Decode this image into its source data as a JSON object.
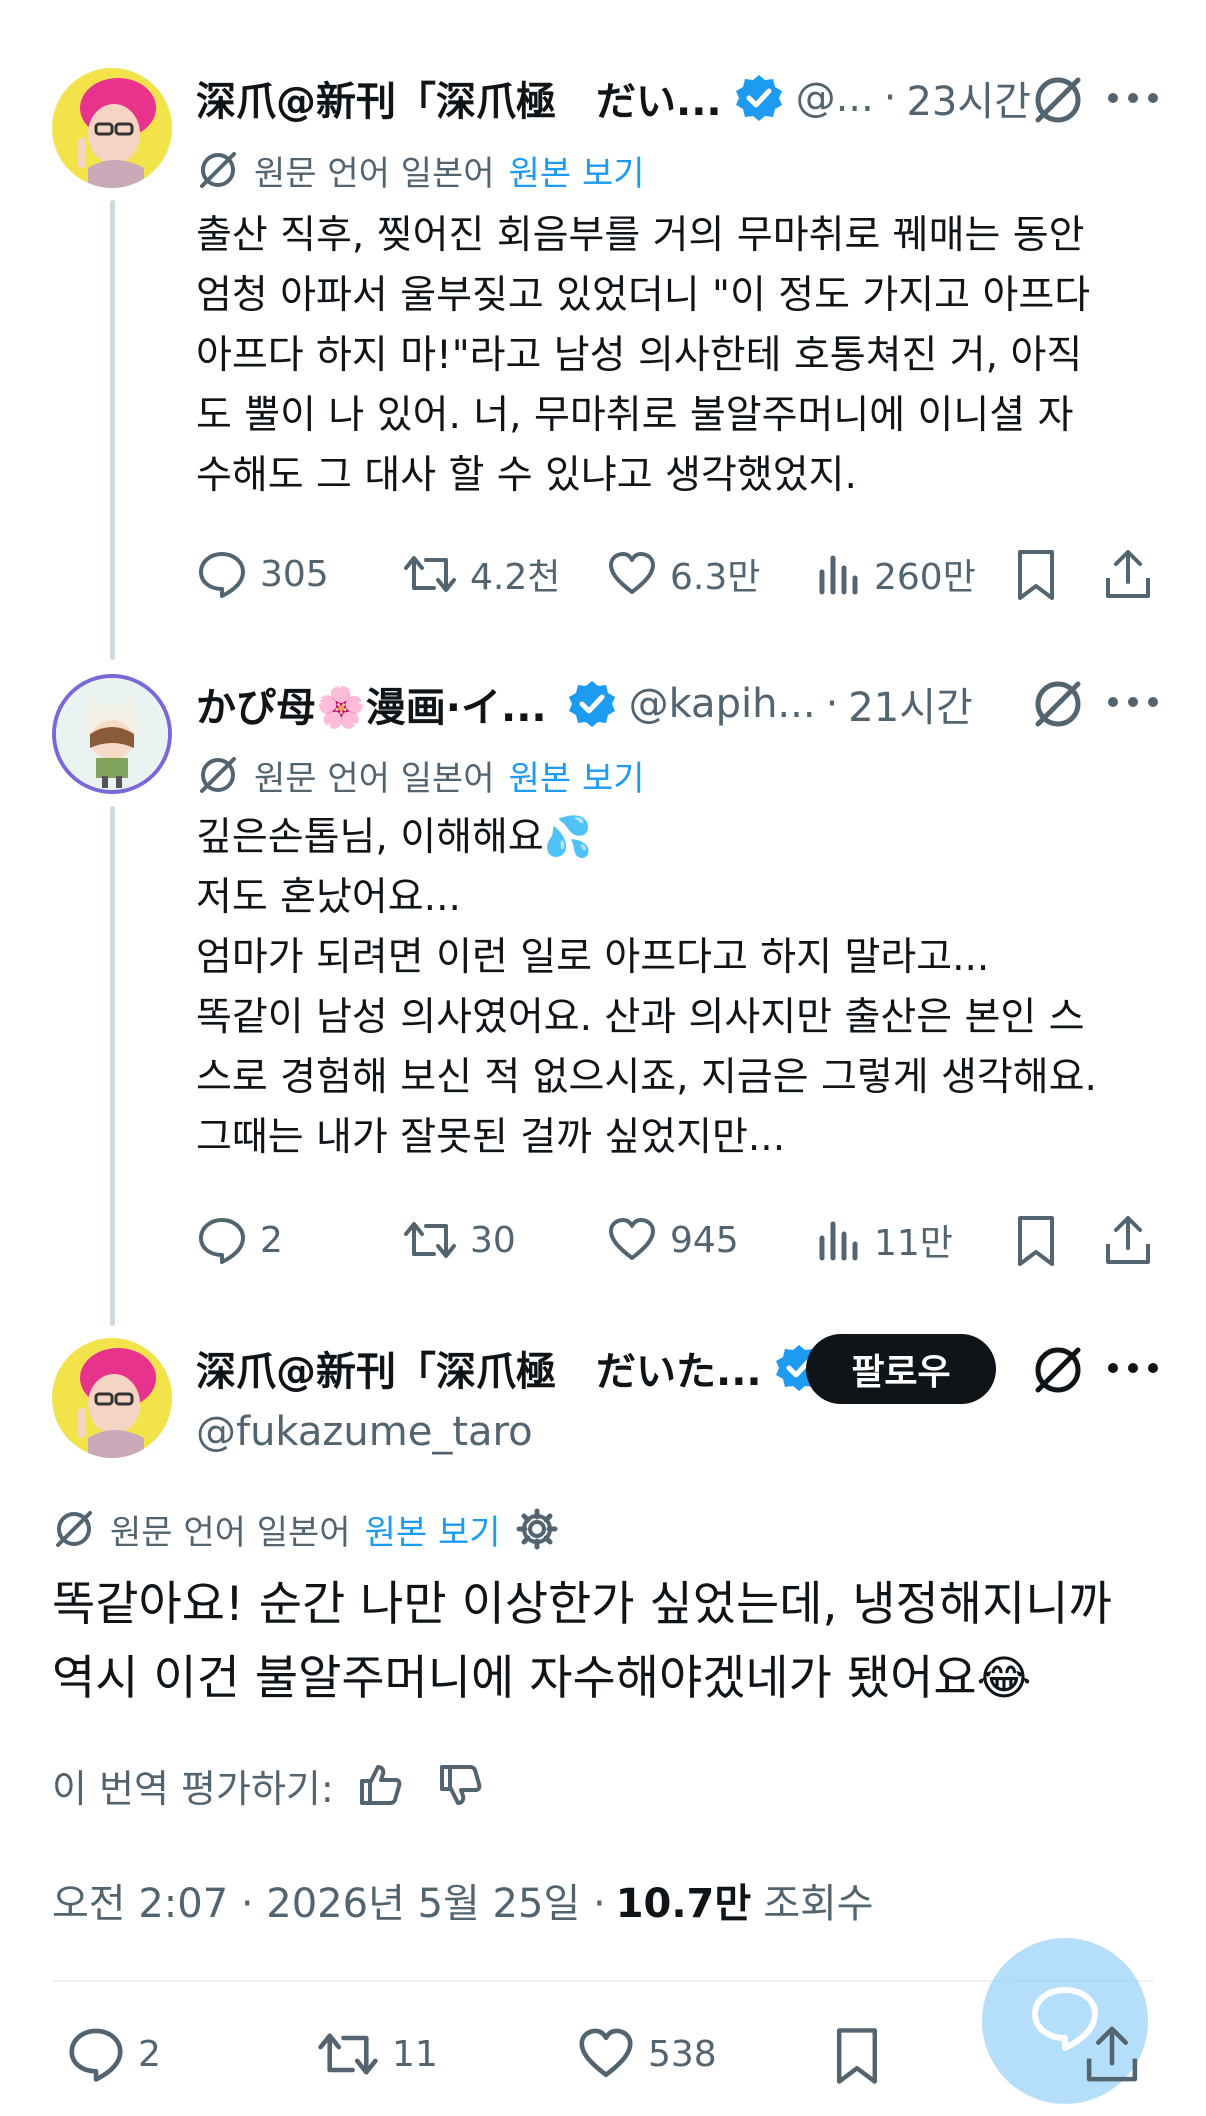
{
  "colors": {
    "accent": "#1d9bf0",
    "text": "#0f1419",
    "secondary": "#536471",
    "verified": "#1d9bf0",
    "fab": "#8ecdf8"
  },
  "tweets": [
    {
      "name": "深爪@新刊「深爪極　だい...",
      "handle": "@...",
      "time": "23시간",
      "translation": {
        "label": "원문 언어 일본어",
        "link": "원본 보기"
      },
      "text": "출산 직후, 찢어진 회음부를 거의 무마취로 꿰매는 동안\n엄청 아파서 울부짖고 있었더니 \"이 정도 가지고 아프다\n아프다 하지 마!\"라고 남성 의사한테 호통쳐진 거, 아직\n도 뿔이 나 있어. 너, 무마취로 불알주머니에 이니셜 자\n수해도 그 대사 할 수 있냐고 생각했었지.",
      "stats": {
        "replies": "305",
        "retweets": "4.2천",
        "likes": "6.3만",
        "views": "260만"
      }
    },
    {
      "name": "かぴ母🌸漫画·イ...",
      "handle": "@kapih...",
      "time": "21시간",
      "translation": {
        "label": "원문 언어 일본어",
        "link": "원본 보기"
      },
      "text": "깊은손톱님, 이해해요💦\n저도 혼났어요...\n엄마가 되려면 이런 일로 아프다고 하지 말라고...\n똑같이 남성 의사였어요. 산과 의사지만 출산은 본인 스\n스로 경험해 보신 적 없으시죠, 지금은 그렇게 생각해요.\n그때는 내가 잘못된 걸까 싶었지만...",
      "stats": {
        "replies": "2",
        "retweets": "30",
        "likes": "945",
        "views": "11만"
      }
    }
  ],
  "main": {
    "name": "深爪@新刊「深爪極　だいた...",
    "handle": "@fukazume_taro",
    "follow_label": "팔로우",
    "translation": {
      "label": "원문 언어 일본어",
      "link": "원본 보기"
    },
    "text": "똑같아요! 순간 나만 이상한가 싶었는데, 냉정해지니까 역시 이건 불알주머니에 자수해야겠네가 됐어요😂",
    "rate_label": "이 번역 평가하기:",
    "timestamp": "오전 2:07 · 2026년 5월 25일 ·",
    "views": "10.7만",
    "views_label": "조회수",
    "stats": {
      "replies": "2",
      "retweets": "11",
      "likes": "538"
    }
  },
  "icons": [
    "reply-icon",
    "retweet-icon",
    "like-icon",
    "views-icon",
    "bookmark-icon",
    "share-icon",
    "grok-icon",
    "more-icon",
    "verified-icon",
    "gear-icon",
    "thumbs-up-icon",
    "thumbs-down-icon",
    "compose-icon"
  ]
}
